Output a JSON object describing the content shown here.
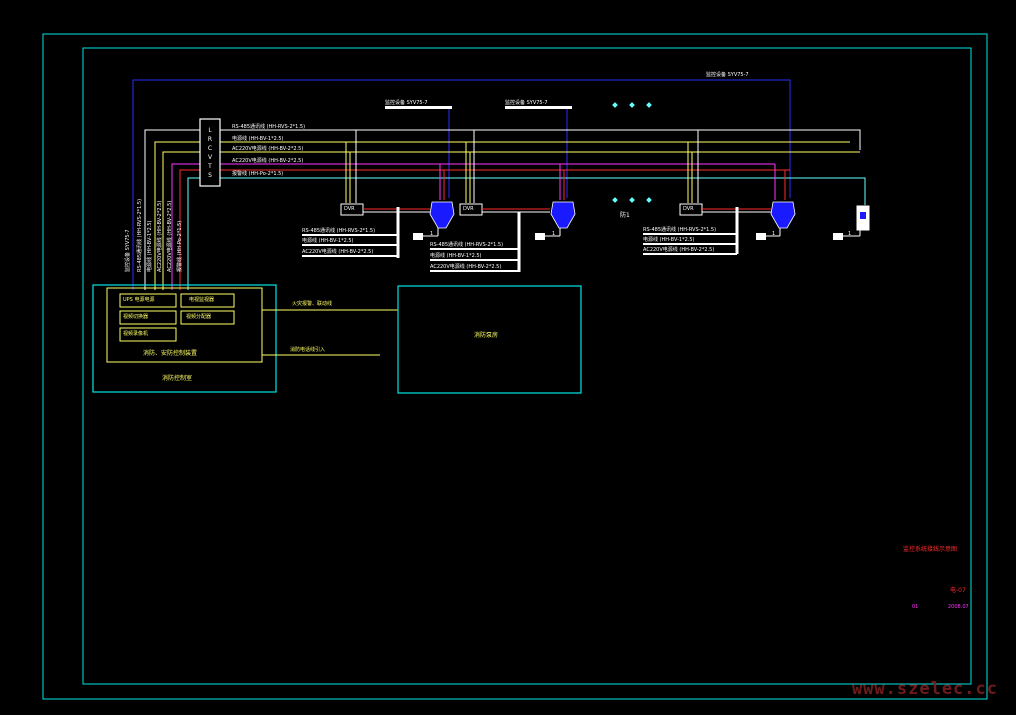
{
  "colors": {
    "background": "#000000",
    "frame": "#00e5e5",
    "blue_wire": "#2b2bff",
    "yellow_wire": "#ffff66",
    "white_wire": "#ffffff",
    "red_wire": "#ff2a2a",
    "magenta_wire": "#ff33ff",
    "cyan_wire": "#66ffff",
    "device_blue": "#1a1aff"
  },
  "trunk": {
    "top_cable": "监控设备 SYV75-7",
    "camera_cable_1": "监控设备 SYV75-7",
    "camera_cable_2": "监控设备 SYV75-7",
    "bus_labels": [
      "RS-485通讯线 (HH-RVS-2*1.5)",
      "电源线 (HH-BV-1*2.5)",
      "AC220V电源线 (HH-BV-2*2.5)",
      "AC220V电源线 (HH-BV-2*2.5)",
      "报警线 (HH-Po-2*1.5)"
    ],
    "junction_box": "L R C V T S"
  },
  "vertical_labels": [
    "监控设备 SYV75-7",
    "RS-485通讯线 (HH-RVS-2*1.5)",
    "电源线 (HH-BV-1*2.5)",
    "AC220V电源线 (HH-BV-2*2.5)",
    "AC220V电源线 (HH-BV-2*2.5)",
    "报警线 (HH-Po-2*1.5)"
  ],
  "group_labels": {
    "group1": [
      "RS-485通讯线 (HH-RVS-2*1.5)",
      "电源线 (HH-BV-1*2.5)",
      "AC220V电源线 (HH-BV-2*2.5)"
    ],
    "group2": [
      "RS-485通讯线 (HH-RVS-2*1.5)",
      "电源线 (HH-BV-1*2.5)",
      "AC220V电源线 (HH-BV-2*2.5)"
    ],
    "group3": [
      "RS-485通讯线 (HH-RVS-2*1.5)",
      "电源线 (HH-BV-1*2.5)",
      "AC220V电源线 (HH-BV-2*2.5)"
    ]
  },
  "devices": {
    "dvr_labels": [
      "DVR",
      "DVR",
      "DVR"
    ],
    "middle_label": "DVR",
    "zone_label": "防1",
    "node_numbers": [
      "1",
      "1",
      "1",
      "1",
      "1",
      "1"
    ]
  },
  "control_room": {
    "inner_items": [
      "UPS 电源电源",
      "电视监视器",
      "视频切换器",
      "视频分配器",
      "视频录像机"
    ],
    "console_label": "消防、安防控制装置",
    "room_label": "消防控制室",
    "link_1": "火灾报警、联动线",
    "link_2": "消防电话线引入"
  },
  "right_box": {
    "label": "消防泵房"
  },
  "title_block": {
    "title": "监控系统接线示意图",
    "drawing_no": "电-07",
    "sheet": "01",
    "date": "2008.07"
  },
  "watermark": "www.szelec.cc"
}
